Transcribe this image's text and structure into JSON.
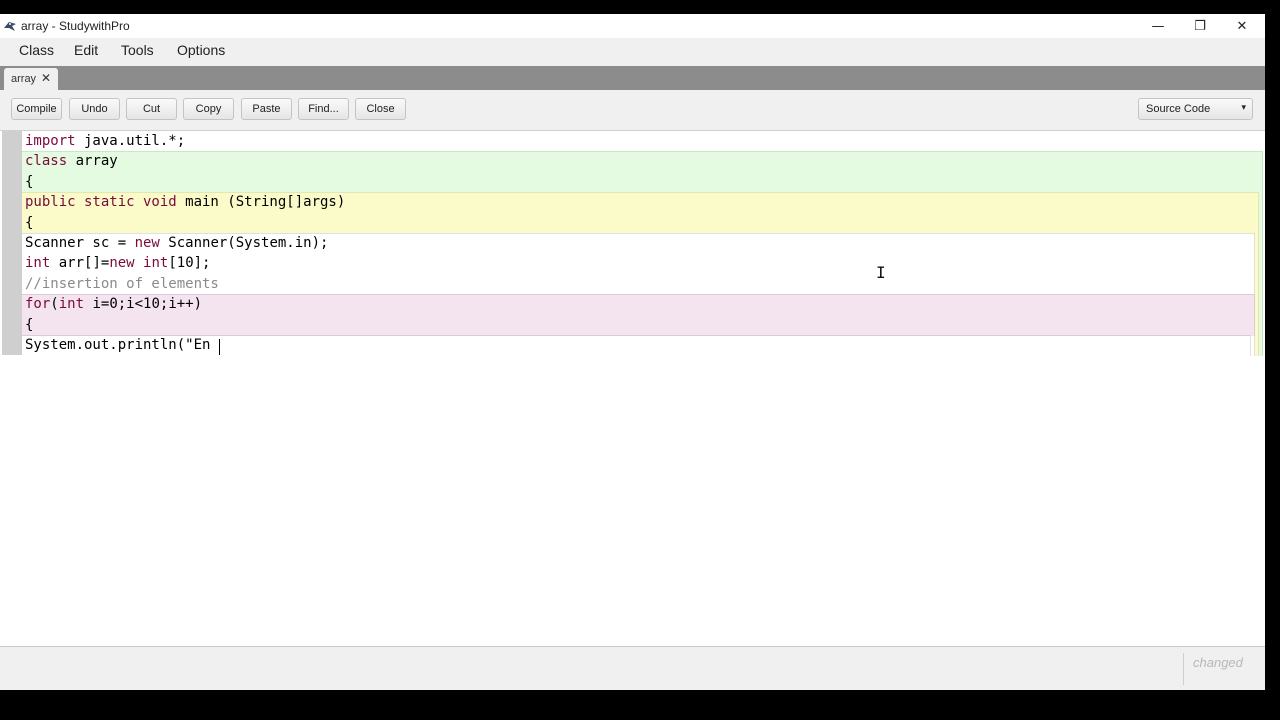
{
  "window": {
    "title": "array - StudywithPro",
    "controls": {
      "minimize": "—",
      "restore": "❐",
      "close": "✕"
    }
  },
  "menu": [
    "Class",
    "Edit",
    "Tools",
    "Options"
  ],
  "tab": {
    "label": "array",
    "close": "✕"
  },
  "toolbar": {
    "buttons": [
      "Compile",
      "Undo",
      "Cut",
      "Copy",
      "Paste",
      "Find...",
      "Close"
    ],
    "view_select": {
      "value": "Source Code",
      "arrow": "▾"
    }
  },
  "editor": {
    "lines": [
      [
        {
          "t": "import",
          "k": "kw"
        },
        {
          "t": " java.util.*;"
        }
      ],
      [
        {
          "t": "class",
          "k": "kw"
        },
        {
          "t": " array"
        }
      ],
      [
        {
          "t": "{"
        }
      ],
      [
        {
          "t": "public static void",
          "k": "kw"
        },
        {
          "t": " main (String[]args)"
        }
      ],
      [
        {
          "t": "{"
        }
      ],
      [
        {
          "t": "Scanner sc = "
        },
        {
          "t": "new",
          "k": "kw"
        },
        {
          "t": " Scanner(System.in);"
        }
      ],
      [
        {
          "t": "int",
          "k": "kw"
        },
        {
          "t": " arr[]="
        },
        {
          "t": "new",
          "k": "kw"
        },
        {
          "t": " "
        },
        {
          "t": "int",
          "k": "kw"
        },
        {
          "t": "[10];"
        }
      ],
      [
        {
          "t": "//insertion of elements",
          "k": "cm"
        }
      ],
      [
        {
          "t": "for",
          "k": "kw"
        },
        {
          "t": "("
        },
        {
          "t": "int",
          "k": "kw"
        },
        {
          "t": " i=0;i<10;i++)"
        }
      ],
      [
        {
          "t": "{"
        }
      ],
      [
        {
          "t": "System.out.println(\"En"
        }
      ]
    ],
    "scope_colors": {
      "class": "#e4fbe2",
      "method": "#fbfbca",
      "body": "#ffffff",
      "loop": "#f4e4f0"
    }
  },
  "status": {
    "text": "changed"
  }
}
